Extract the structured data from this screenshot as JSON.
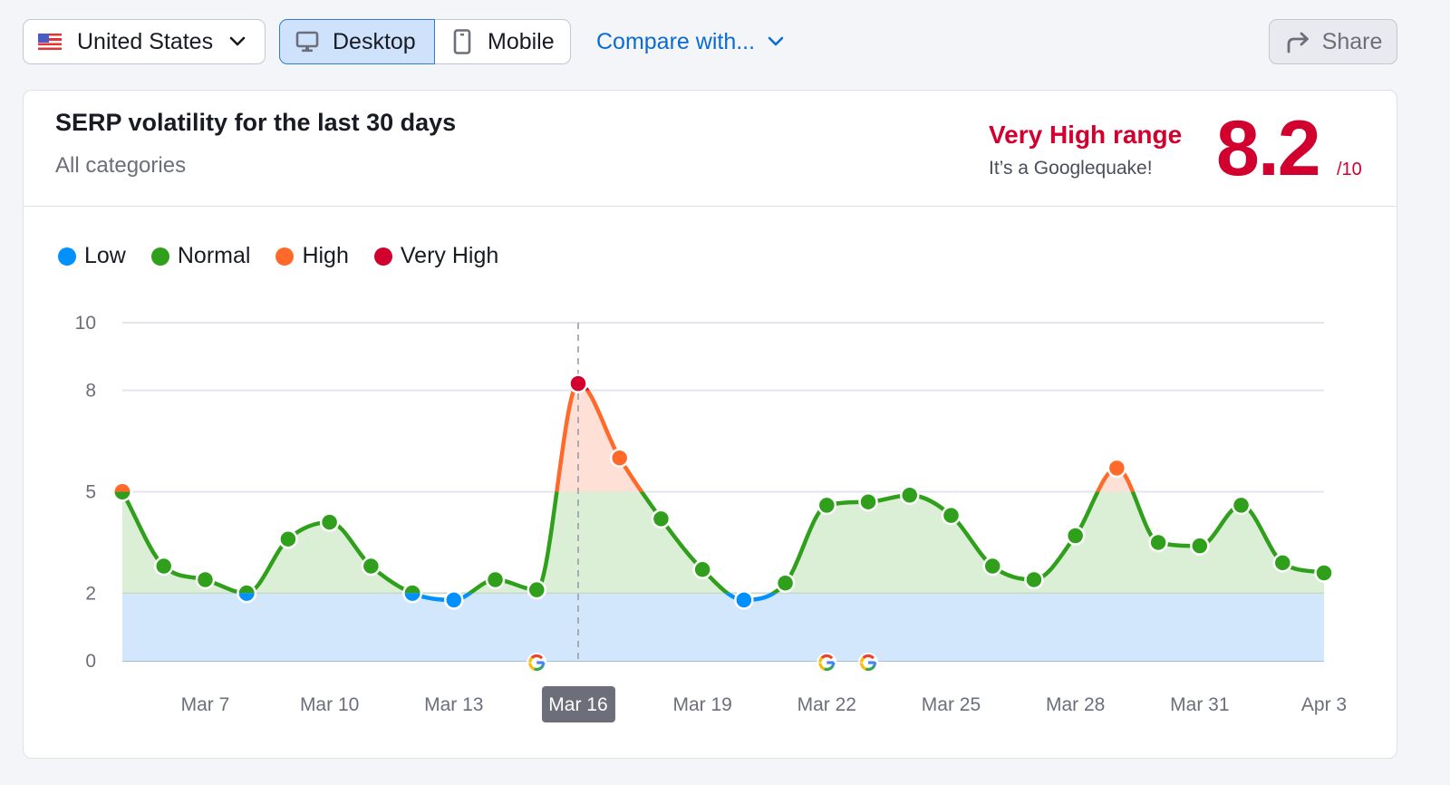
{
  "toolbar": {
    "country": {
      "label": "United States",
      "flag": "us-flag-icon"
    },
    "device": {
      "options": [
        {
          "label": "Desktop",
          "icon": "desktop-icon",
          "selected": true
        },
        {
          "label": "Mobile",
          "icon": "mobile-icon",
          "selected": false
        }
      ]
    },
    "compare_label": "Compare with...",
    "share_label": "Share"
  },
  "card": {
    "title": "SERP volatility for the last 30 days",
    "subtitle": "All categories",
    "range_label": "Very High range",
    "range_sub": "It’s a Googlequake!",
    "score": "8.2",
    "score_max": "/10"
  },
  "colors": {
    "low": "#0090ff",
    "normal": "#30a01c",
    "high": "#ff6a2a",
    "very_high": "#d1002f",
    "accent": "#0a6cd2"
  },
  "chart_data": {
    "type": "area",
    "title": "SERP volatility for the last 30 days",
    "xlabel": "",
    "ylabel": "",
    "ylim": [
      0,
      10
    ],
    "yticks": [
      0,
      2,
      5,
      8,
      10
    ],
    "grid": true,
    "legend_position": "top-left",
    "legend": [
      {
        "name": "Low",
        "range": [
          0,
          2
        ],
        "color": "#0090ff"
      },
      {
        "name": "Normal",
        "range": [
          2,
          5
        ],
        "color": "#30a01c"
      },
      {
        "name": "High",
        "range": [
          5,
          8
        ],
        "color": "#ff6a2a"
      },
      {
        "name": "Very High",
        "range": [
          8,
          10
        ],
        "color": "#d1002f"
      }
    ],
    "x": [
      "Mar 5",
      "Mar 6",
      "Mar 7",
      "Mar 8",
      "Mar 9",
      "Mar 10",
      "Mar 11",
      "Mar 12",
      "Mar 13",
      "Mar 14",
      "Mar 15",
      "Mar 16",
      "Mar 17",
      "Mar 18",
      "Mar 19",
      "Mar 20",
      "Mar 21",
      "Mar 22",
      "Mar 23",
      "Mar 24",
      "Mar 25",
      "Mar 26",
      "Mar 27",
      "Mar 28",
      "Mar 29",
      "Mar 30",
      "Mar 31",
      "Apr 1",
      "Apr 2",
      "Apr 3"
    ],
    "values": [
      5.0,
      2.8,
      2.4,
      2.0,
      3.6,
      4.1,
      2.8,
      2.0,
      1.8,
      2.4,
      2.1,
      8.2,
      6.0,
      4.2,
      2.7,
      1.8,
      2.3,
      4.6,
      4.7,
      4.9,
      4.3,
      2.8,
      2.4,
      3.7,
      5.7,
      3.5,
      3.4,
      4.6,
      2.9,
      2.6
    ],
    "xtick_labels": [
      "Mar 7",
      "Mar 10",
      "Mar 13",
      "Mar 16",
      "Mar 19",
      "Mar 22",
      "Mar 25",
      "Mar 28",
      "Mar 31",
      "Apr 3"
    ],
    "highlighted_date": "Mar 16",
    "google_update_markers": [
      "Mar 15",
      "Mar 22",
      "Mar 23"
    ]
  }
}
